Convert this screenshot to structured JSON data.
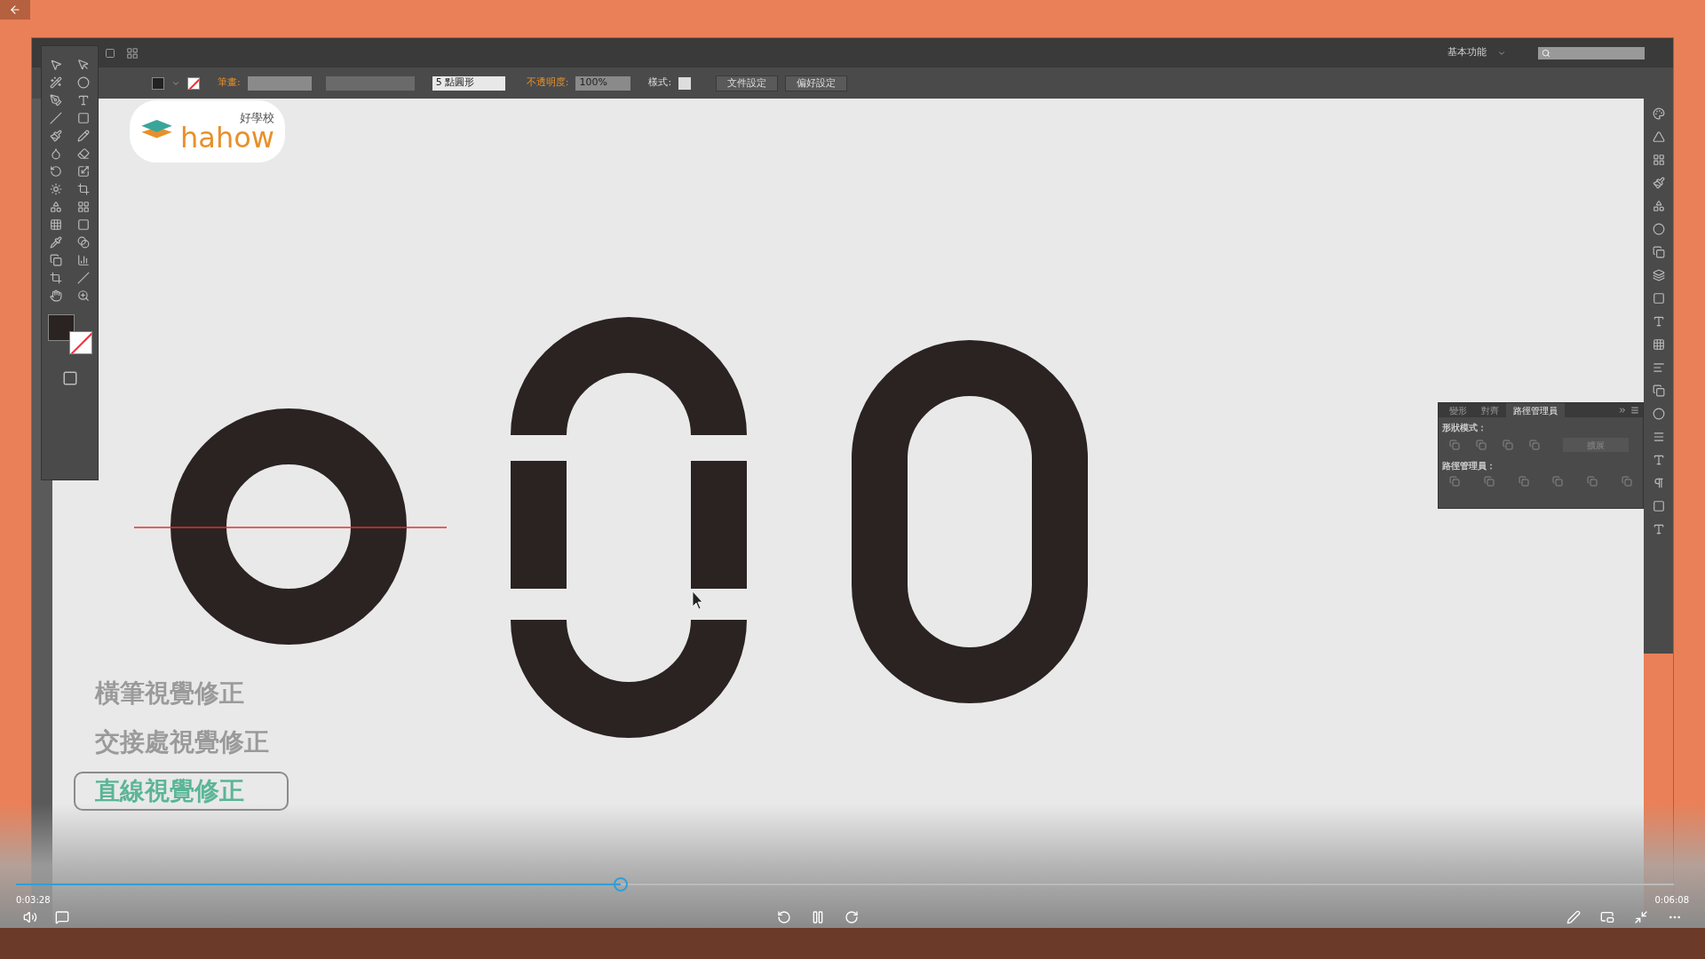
{
  "app": {
    "workspace": "基本功能",
    "control_bar": {
      "stroke_label": "筆畫:",
      "brush": "5 點圓形",
      "opacity_label": "不透明度:",
      "opacity": "100%",
      "style_label": "樣式:",
      "buttons": [
        "文件設定",
        "偏好設定"
      ]
    },
    "logo": {
      "chinese": "好學校",
      "wordmark": "hahow"
    },
    "pathfinder": {
      "tabs": [
        {
          "label": "變形",
          "selected": false
        },
        {
          "label": "對齊",
          "selected": false
        },
        {
          "label": "路徑管理員",
          "selected": true
        }
      ],
      "shape_modes_label": "形狀模式：",
      "expand_button": "擴展",
      "pathfinders_label": "路徑管理員："
    },
    "captions": [
      {
        "text": "橫筆視覺修正",
        "selected": false
      },
      {
        "text": "交接處視覺修正",
        "selected": false
      },
      {
        "text": "直線視覺修正",
        "selected": true
      }
    ]
  },
  "video": {
    "elapsed": "0:03:28",
    "duration": "0:06:08",
    "progress": {
      "level": 0.365
    }
  }
}
